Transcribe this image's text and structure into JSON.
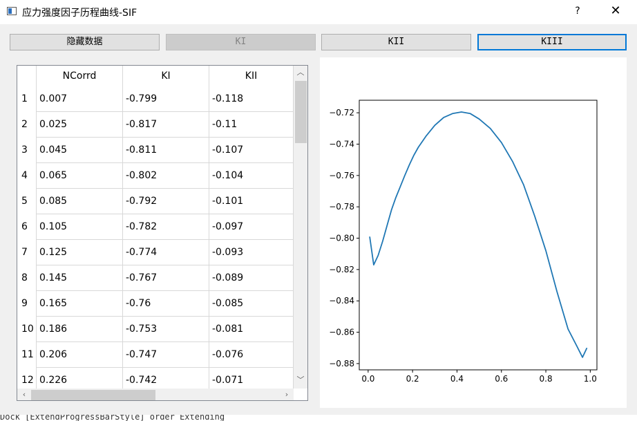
{
  "window": {
    "title": "应力强度因子历程曲线-SIF",
    "help_label": "?",
    "close_label": "✕"
  },
  "toolbar": {
    "hide_data_label": "隐藏数据",
    "k1_label": "KI",
    "k2_label": "KII",
    "k3_label": "KIII"
  },
  "table": {
    "columns": [
      "NCorrd",
      "KI",
      "KII"
    ],
    "rows": [
      {
        "index": "1",
        "ncorrd": "0.007",
        "ki": "-0.799",
        "kii": "-0.118"
      },
      {
        "index": "2",
        "ncorrd": "0.025",
        "ki": "-0.817",
        "kii": "-0.11"
      },
      {
        "index": "3",
        "ncorrd": "0.045",
        "ki": "-0.811",
        "kii": "-0.107"
      },
      {
        "index": "4",
        "ncorrd": "0.065",
        "ki": "-0.802",
        "kii": "-0.104"
      },
      {
        "index": "5",
        "ncorrd": "0.085",
        "ki": "-0.792",
        "kii": "-0.101"
      },
      {
        "index": "6",
        "ncorrd": "0.105",
        "ki": "-0.782",
        "kii": "-0.097"
      },
      {
        "index": "7",
        "ncorrd": "0.125",
        "ki": "-0.774",
        "kii": "-0.093"
      },
      {
        "index": "8",
        "ncorrd": "0.145",
        "ki": "-0.767",
        "kii": "-0.089"
      },
      {
        "index": "9",
        "ncorrd": "0.165",
        "ki": "-0.76",
        "kii": "-0.085"
      },
      {
        "index": "10",
        "ncorrd": "0.186",
        "ki": "-0.753",
        "kii": "-0.081"
      },
      {
        "index": "11",
        "ncorrd": "0.206",
        "ki": "-0.747",
        "kii": "-0.076"
      },
      {
        "index": "12",
        "ncorrd": "0.226",
        "ki": "-0.742",
        "kii": "-0.071"
      }
    ]
  },
  "status": {
    "text": "Dock [ExtendProgressBarStyle] order Extending"
  },
  "chart_data": {
    "type": "line",
    "x": [
      0.007,
      0.025,
      0.045,
      0.065,
      0.085,
      0.105,
      0.125,
      0.145,
      0.165,
      0.186,
      0.206,
      0.226,
      0.26,
      0.3,
      0.34,
      0.38,
      0.42,
      0.46,
      0.5,
      0.55,
      0.6,
      0.65,
      0.7,
      0.75,
      0.8,
      0.85,
      0.9,
      0.94,
      0.965,
      0.985
    ],
    "y": [
      -0.799,
      -0.817,
      -0.811,
      -0.802,
      -0.792,
      -0.782,
      -0.774,
      -0.767,
      -0.76,
      -0.753,
      -0.747,
      -0.742,
      -0.735,
      -0.728,
      -0.723,
      -0.7205,
      -0.7195,
      -0.7205,
      -0.724,
      -0.73,
      -0.739,
      -0.751,
      -0.766,
      -0.786,
      -0.808,
      -0.834,
      -0.858,
      -0.869,
      -0.876,
      -0.87
    ],
    "series_color": "#1f77b4",
    "xlim": [
      -0.04,
      1.03
    ],
    "ylim": [
      -0.884,
      -0.712
    ],
    "xticks": [
      0.0,
      0.2,
      0.4,
      0.6,
      0.8,
      1.0
    ],
    "xtick_labels": [
      "0.0",
      "0.2",
      "0.4",
      "0.6",
      "0.8",
      "1.0"
    ],
    "yticks": [
      -0.72,
      -0.74,
      -0.76,
      -0.78,
      -0.8,
      -0.82,
      -0.84,
      -0.86,
      -0.88
    ],
    "ytick_labels": [
      "−0.72",
      "−0.74",
      "−0.76",
      "−0.78",
      "−0.80",
      "−0.82",
      "−0.84",
      "−0.86",
      "−0.88"
    ],
    "grid": false,
    "title": "",
    "xlabel": "",
    "ylabel": ""
  }
}
